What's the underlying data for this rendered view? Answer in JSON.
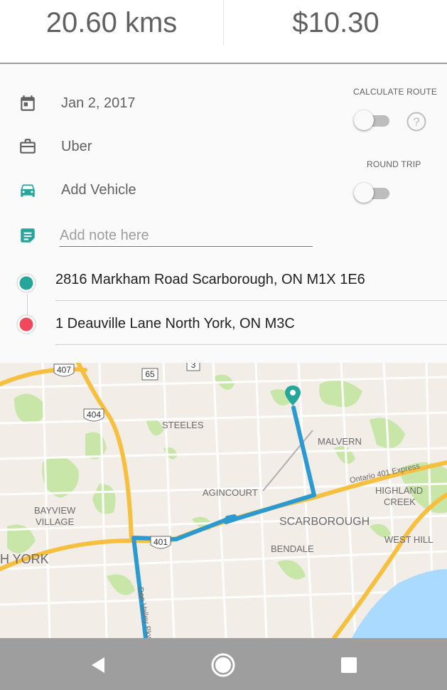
{
  "summary": {
    "distance": "20.60 kms",
    "cost": "$10.30"
  },
  "form": {
    "date": "Jan 2, 2017",
    "category": "Uber",
    "vehicle": "Add Vehicle",
    "note_placeholder": "Add note here",
    "calculate_route_label": "CALCULATE ROUTE",
    "calculate_route_on": false,
    "help_icon": "help-circle-icon",
    "round_trip_label": "ROUND TRIP",
    "round_trip_on": false
  },
  "locations": {
    "start": "2816 Markham Road Scarborough, ON M1X 1E6",
    "end": "1 Deauville Lane North York, ON M3C"
  },
  "map": {
    "labels": {
      "steeles": "STEELES",
      "malvern": "MALVERN",
      "agincourt": "AGINCOURT",
      "scarborough": "SCARBOROUGH",
      "bayview_village": "BAYVIEW\nVILLAGE",
      "highland_creek": "HIGHLAND\nCREEK",
      "bendale": "BENDALE",
      "west_hill": "WEST HILL",
      "north_york": "H YORK",
      "ontario_401": "Ontario 401 Express",
      "don_valley": "Don Valley Pkwy"
    },
    "shields": {
      "h407": "407",
      "h404": "404",
      "h401": "401",
      "r65": "65",
      "r3": "3"
    },
    "colors": {
      "route": "#2b9ad0",
      "pin": "#26a69a",
      "highway": "#f6bf3d",
      "water": "#aadaff",
      "park": "#c7e6a8"
    }
  },
  "nav": {
    "back": "back-icon",
    "home": "home-icon",
    "recents": "recents-icon"
  },
  "colors": {
    "accent": "#26a69a",
    "start_dot": "#26a69a",
    "end_dot": "#f0495b"
  }
}
